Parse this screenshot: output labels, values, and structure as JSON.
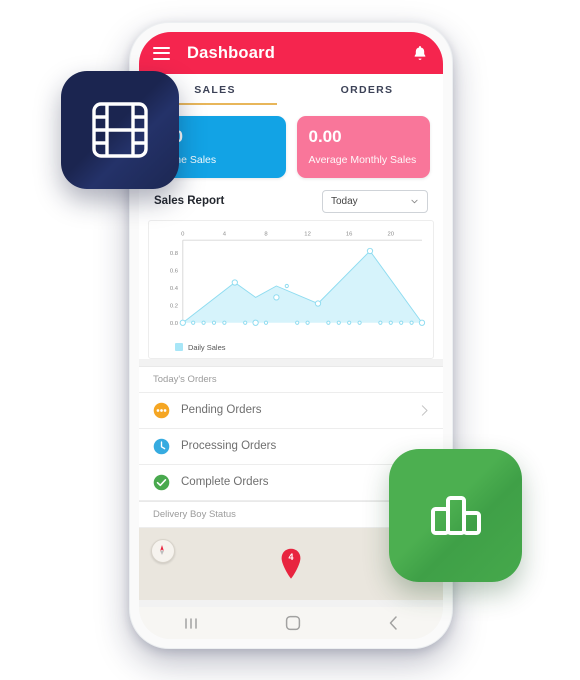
{
  "app": {
    "header": {
      "title": "Dashboard",
      "menu_icon": "hamburger-menu-icon",
      "bell_icon": "notification-bell-icon",
      "bg_color": "#F5254E"
    },
    "tabs": [
      {
        "label": "SALES",
        "active": true
      },
      {
        "label": "ORDERS",
        "active": false
      }
    ],
    "tab_indicator_color": "#E8B65A",
    "stat_cards": [
      {
        "value": "00",
        "label": "Time Sales",
        "color": "#12A3E5",
        "name": "all-time-sales-card"
      },
      {
        "value": "0.00",
        "label": "Average Monthly Sales",
        "color": "#F9769A",
        "name": "average-monthly-sales-card"
      }
    ],
    "sales_report": {
      "title": "Sales Report",
      "range_selected": "Today",
      "range_options": [
        "Today"
      ]
    },
    "orders_section": {
      "heading": "Today's Orders",
      "items": [
        {
          "label": "Pending Orders",
          "icon": "pending-dots-icon",
          "color": "#F5A623",
          "has_chevron": true
        },
        {
          "label": "Processing Orders",
          "icon": "clock-icon",
          "color": "#36ABE0",
          "has_chevron": false
        },
        {
          "label": "Complete Orders",
          "icon": "check-circle-icon",
          "color": "#49A94E",
          "has_chevron": false
        }
      ]
    },
    "delivery_section": {
      "heading": "Delivery Boy Status",
      "map": {
        "compass_icon": "compass-icon",
        "marker_label": "4",
        "marker_color": "#E8243F",
        "bg_color": "#EAE6DE"
      }
    },
    "system_nav": {
      "recents_icon": "recents-icon",
      "home_icon": "home-icon",
      "back_icon": "back-icon"
    }
  },
  "floating_icons": [
    {
      "name": "film-grid-app-icon",
      "glyph": "film-strip-icon",
      "bg_color": "#1B2550"
    },
    {
      "name": "bar-chart-app-icon",
      "glyph": "bar-chart-icon",
      "bg_color": "#4CAF50"
    }
  ],
  "chart_data": {
    "type": "area",
    "title": "Sales Report",
    "series": [
      {
        "name": "Daily Sales",
        "color": "#A8E6F7",
        "x": [
          0,
          1,
          2,
          3,
          4,
          5,
          6,
          7,
          8,
          9,
          10,
          11,
          12,
          13,
          14,
          15,
          16,
          17,
          18,
          19,
          20,
          21,
          22,
          23
        ],
        "values": [
          0.0,
          0.0,
          0.0,
          0.0,
          0.0,
          0.46,
          0.0,
          0.0,
          0.0,
          0.29,
          0.42,
          0.0,
          0.0,
          0.22,
          0.0,
          0.0,
          0.0,
          0.0,
          0.82,
          0.0,
          0.0,
          0.0,
          0.0,
          0.0
        ]
      }
    ],
    "vertex_x": [
      0,
      5,
      7,
      9,
      13,
      18,
      23
    ],
    "vertex_y": [
      0.0,
      0.46,
      0.29,
      0.42,
      0.22,
      0.82,
      0.0
    ],
    "xlabel": "",
    "ylabel": "",
    "xticks": [
      0,
      4,
      8,
      12,
      16,
      20
    ],
    "yticks": [
      0.0,
      0.2,
      0.4,
      0.6,
      0.8
    ],
    "xlim": [
      0,
      23
    ],
    "ylim": [
      0,
      0.9
    ],
    "x_axis_position": "top",
    "grid": false,
    "legend": {
      "position": "bottom-left",
      "entries": [
        "Daily Sales"
      ]
    }
  }
}
